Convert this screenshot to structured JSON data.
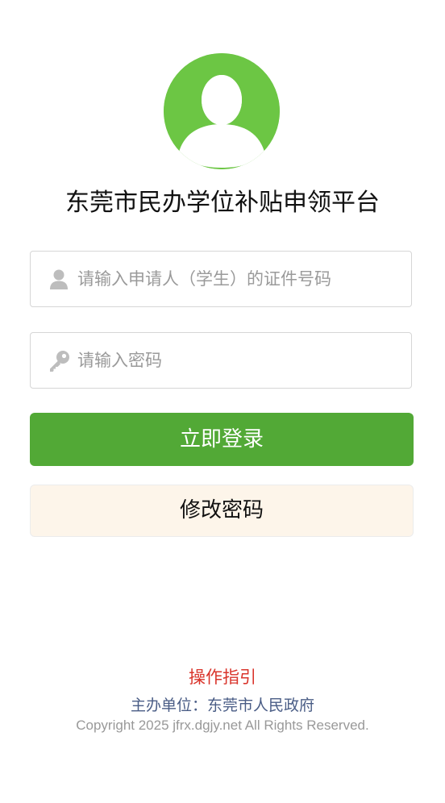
{
  "header": {
    "avatar_icon": "user-avatar-icon",
    "avatar_color": "#6cc644",
    "title": "东莞市民办学位补贴申领平台"
  },
  "form": {
    "id_field": {
      "icon": "person-icon",
      "placeholder": "请输入申请人（学生）的证件号码",
      "value": ""
    },
    "password_field": {
      "icon": "key-icon",
      "placeholder": "请输入密码",
      "value": ""
    },
    "login_button": "立即登录",
    "change_password_button": "修改密码"
  },
  "footer": {
    "guide_link": "操作指引",
    "sponsor": "主办单位：东莞市人民政府",
    "copyright": "Copyright 2025 jfrx.dgjy.net All Rights Reserved."
  },
  "colors": {
    "primary_green": "#52a936",
    "guide_red": "#d9342b",
    "sponsor_blue": "#4a5d86",
    "secondary_button_bg": "#fdf5ea"
  }
}
